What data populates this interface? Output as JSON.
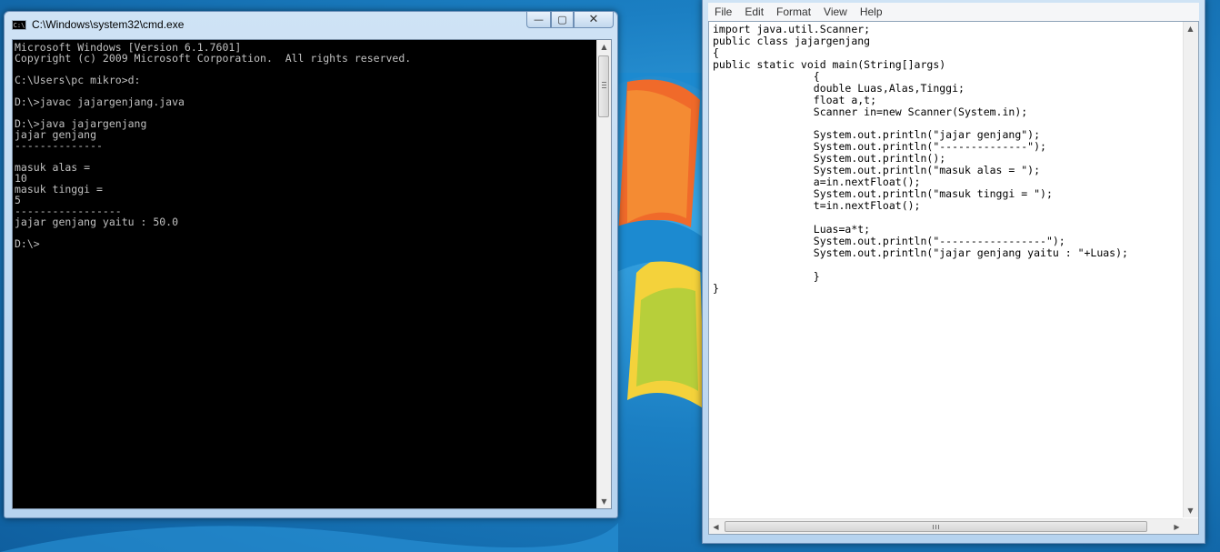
{
  "cmd": {
    "title": "C:\\Windows\\system32\\cmd.exe",
    "icon": "cmd-icon",
    "icon_text": "C:\\",
    "buttons": {
      "minimize": "—",
      "maximize": "▢",
      "close": "✕"
    },
    "output": "Microsoft Windows [Version 6.1.7601]\nCopyright (c) 2009 Microsoft Corporation.  All rights reserved.\n\nC:\\Users\\pc mikro>d:\n\nD:\\>javac jajargenjang.java\n\nD:\\>java jajargenjang\njajar genjang\n--------------\n\nmasuk alas =\n10\nmasuk tinggi =\n5\n-----------------\njajar genjang yaitu : 50.0\n\nD:\\>"
  },
  "notepad": {
    "menu": [
      "File",
      "Edit",
      "Format",
      "View",
      "Help"
    ],
    "content": "import java.util.Scanner;\npublic class jajargenjang\n{\npublic static void main(String[]args)\n                {\n                double Luas,Alas,Tinggi;\n                float a,t;\n                Scanner in=new Scanner(System.in);\n\n                System.out.println(\"jajar genjang\");\n                System.out.println(\"--------------\");\n                System.out.println();\n                System.out.println(\"masuk alas = \");\n                a=in.nextFloat();\n                System.out.println(\"masuk tinggi = \");\n                t=in.nextFloat();\n\n                Luas=a*t;\n                System.out.println(\"-----------------\");\n                System.out.println(\"jajar genjang yaitu : \"+Luas);\n\n                }\n}"
  },
  "scroll": {
    "up": "▲",
    "down": "▼",
    "left": "◀",
    "right": "▶"
  },
  "colors": {
    "console_bg": "#000000",
    "console_fg": "#c0c0c0",
    "desktop": "#1f86c9"
  }
}
